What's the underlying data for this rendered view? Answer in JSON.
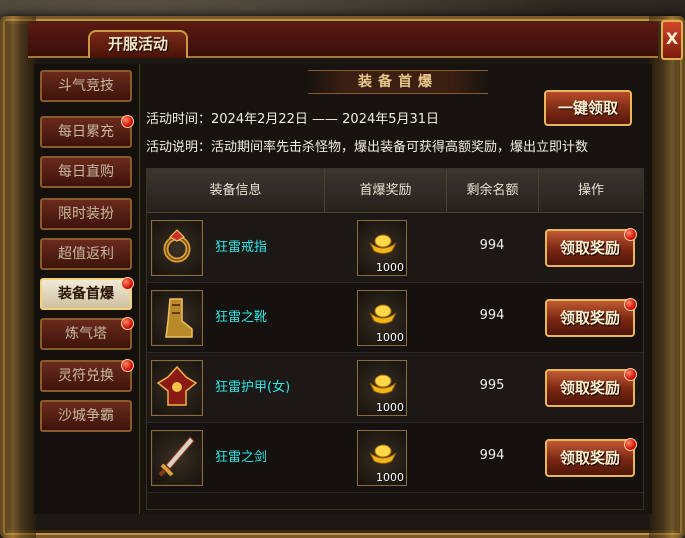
{
  "window": {
    "title": "开服活动",
    "close_label": "X"
  },
  "sidebar": {
    "items": [
      {
        "label": "斗气竞技",
        "active": false,
        "dot": false
      },
      {
        "label": "每日累充",
        "active": false,
        "dot": true
      },
      {
        "label": "每日直购",
        "active": false,
        "dot": false
      },
      {
        "label": "限时装扮",
        "active": false,
        "dot": false
      },
      {
        "label": "超值返利",
        "active": false,
        "dot": false
      },
      {
        "label": "装备首爆",
        "active": true,
        "dot": true
      },
      {
        "label": "炼气塔",
        "active": false,
        "dot": true
      },
      {
        "label": "灵符兑换",
        "active": false,
        "dot": true
      },
      {
        "label": "沙城争霸",
        "active": false,
        "dot": false
      }
    ]
  },
  "main": {
    "banner": "装备首爆",
    "one_key_label": "一键领取",
    "activity_time": "活动时间：2024年2月22日 —— 2024年5月31日",
    "activity_desc": "活动说明：活动期间率先击杀怪物，爆出装备可获得高额奖励，爆出立即计数",
    "columns": [
      "装备信息",
      "首爆奖励",
      "剩余名额",
      "操作"
    ],
    "rows": [
      {
        "item_icon": "ring-icon",
        "name": "狂雷戒指",
        "reward_icon": "gold-ingot-icon",
        "reward_count": "1000",
        "remaining": "994",
        "button": "领取奖励"
      },
      {
        "item_icon": "boots-icon",
        "name": "狂雷之靴",
        "reward_icon": "gold-ingot-icon",
        "reward_count": "1000",
        "remaining": "994",
        "button": "领取奖励"
      },
      {
        "item_icon": "armor-icon",
        "name": "狂雷护甲(女)",
        "reward_icon": "gold-ingot-icon",
        "reward_count": "1000",
        "remaining": "995",
        "button": "领取奖励"
      },
      {
        "item_icon": "sword-icon",
        "name": "狂雷之剑",
        "reward_icon": "gold-ingot-icon",
        "reward_count": "1000",
        "remaining": "994",
        "button": "领取奖励"
      }
    ]
  },
  "colors": {
    "item_name": "#2fe6e6",
    "button_border": "#e9b75a",
    "dot": "#d0140a"
  }
}
